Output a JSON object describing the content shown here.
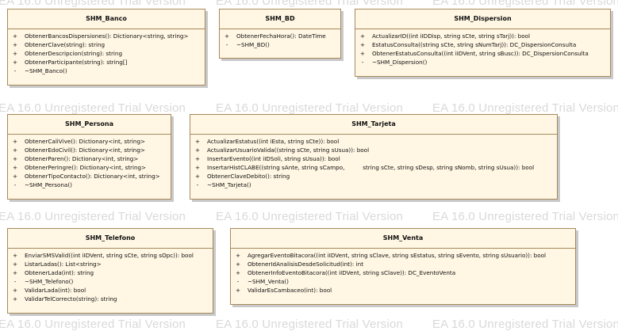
{
  "watermark": "EA 16.0 Unregistered Trial Version",
  "classes": [
    {
      "name": "SHM_Banco",
      "operations": [
        {
          "vis": "+",
          "sig": "ObtenerBancosDispersiones(): Dictionary<string, string>"
        },
        {
          "vis": "+",
          "sig": "ObtenerClave(string): string"
        },
        {
          "vis": "+",
          "sig": "ObtenerDescripcion(string): string"
        },
        {
          "vis": "+",
          "sig": "ObtenerParticipante(string): string[]"
        },
        {
          "vis": "-",
          "sig": "~SHM_Banco()"
        }
      ]
    },
    {
      "name": "SHM_BD",
      "operations": [
        {
          "vis": "+",
          "sig": "ObtenerFechaHora(): DateTime"
        },
        {
          "vis": "-",
          "sig": "~SHM_BD()"
        }
      ]
    },
    {
      "name": "SHM_Dispersion",
      "operations": [
        {
          "vis": "+",
          "sig": "ActualizarID((int iIDDisp, string sCte, string sTarj)): bool"
        },
        {
          "vis": "+",
          "sig": "EstatusConsulta((string sCte, string sNumTarj)): DC_DispersionConsulta"
        },
        {
          "vis": "+",
          "sig": "ObtenerEstatusConsulta((int iIDVent, string sBusc)): DC_DispersionConsulta"
        },
        {
          "vis": "-",
          "sig": "~SHM_Dispersion()"
        }
      ]
    },
    {
      "name": "SHM_Persona",
      "operations": [
        {
          "vis": "+",
          "sig": "ObtenerCaliVive(): Dictionary<int, string>"
        },
        {
          "vis": "+",
          "sig": "ObtenerEdoCivil(): Dictionary<int, string>"
        },
        {
          "vis": "+",
          "sig": "ObtenerParen(): Dictionary<int, string>"
        },
        {
          "vis": "+",
          "sig": "ObtenerPerIngre(): Dictionary<int, string>"
        },
        {
          "vis": "+",
          "sig": "ObtenerTipoContacto(): Dictionary<int, string>"
        },
        {
          "vis": "-",
          "sig": "~SHM_Persona()"
        }
      ]
    },
    {
      "name": "SHM_Tarjeta",
      "operations": [
        {
          "vis": "+",
          "sig": "ActualizarEstatus((int iEsta, string sCte)): bool"
        },
        {
          "vis": "+",
          "sig": "ActualizarUsuarioValida((string sCte, string sUsua)): bool"
        },
        {
          "vis": "+",
          "sig": "InsertarEvento((int iIDSoli, string sUsua)): bool"
        },
        {
          "vis": "+",
          "sig": "InsertarHistCLABE((string sAnte, string sCampo,          string sCte, string sDesp, string sNomb, string sUsua)): bool"
        },
        {
          "vis": "+",
          "sig": "ObtenerClaveDebito(): string"
        },
        {
          "vis": "-",
          "sig": "~SHM_Tarjeta()"
        }
      ]
    },
    {
      "name": "SHM_Telefono",
      "operations": [
        {
          "vis": "+",
          "sig": "EnviarSMSValid((int iIDVent, string sCte, string sOpc)): bool"
        },
        {
          "vis": "+",
          "sig": "ListarLadas(): List<string>"
        },
        {
          "vis": "+",
          "sig": "ObtenerLada(int): string"
        },
        {
          "vis": "-",
          "sig": "~SHM_Telefono()"
        },
        {
          "vis": "+",
          "sig": "ValidarLada(int): bool"
        },
        {
          "vis": "+",
          "sig": "ValidarTelCorrecto(string): string"
        }
      ]
    },
    {
      "name": "SHM_Venta",
      "operations": [
        {
          "vis": "+",
          "sig": "AgregarEventoBitacora((int iIDVent, string sClave, string sEstatus, string sEvento, string sUsuario)): bool"
        },
        {
          "vis": "+",
          "sig": "ObtenerIdAnalisisDesdeSolicitud(int): int"
        },
        {
          "vis": "+",
          "sig": "ObtenerInfoEventoBitacora((int iIDVent, string sClave)): DC_EventoVenta"
        },
        {
          "vis": "-",
          "sig": "~SHM_Venta()"
        },
        {
          "vis": "+",
          "sig": "ValidarEsCambaceo(int): bool"
        }
      ]
    }
  ]
}
